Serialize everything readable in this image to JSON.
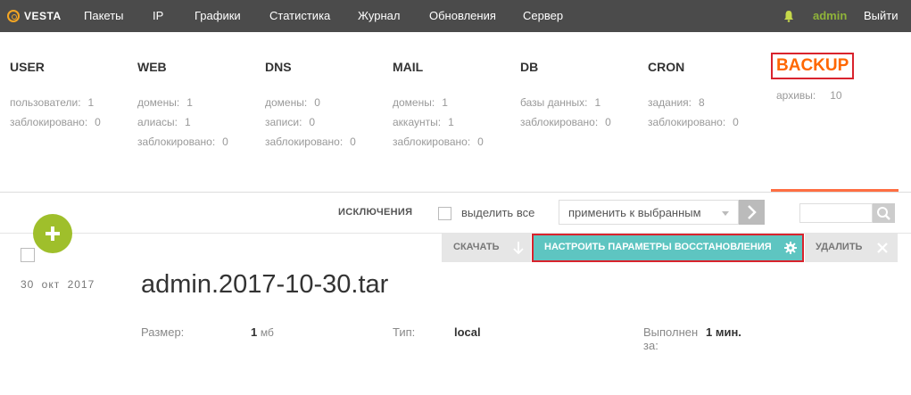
{
  "nav": {
    "logo": "VESTA",
    "items": [
      "Пакеты",
      "IP",
      "Графики",
      "Статистика",
      "Журнал",
      "Обновления",
      "Сервер"
    ],
    "user": "admin",
    "logout": "Выйти"
  },
  "stats": {
    "user": {
      "title": "USER",
      "rows": [
        [
          "пользователи:",
          "1"
        ],
        [
          "заблокировано:",
          "0"
        ]
      ]
    },
    "web": {
      "title": "WEB",
      "rows": [
        [
          "домены:",
          "1"
        ],
        [
          "алиасы:",
          "1"
        ],
        [
          "заблокировано:",
          "0"
        ]
      ]
    },
    "dns": {
      "title": "DNS",
      "rows": [
        [
          "домены:",
          "0"
        ],
        [
          "записи:",
          "0"
        ],
        [
          "заблокировано:",
          "0"
        ]
      ]
    },
    "mail": {
      "title": "MAIL",
      "rows": [
        [
          "домены:",
          "1"
        ],
        [
          "аккаунты:",
          "1"
        ],
        [
          "заблокировано:",
          "0"
        ]
      ]
    },
    "db": {
      "title": "DB",
      "rows": [
        [
          "базы данных:",
          "1"
        ],
        [
          "заблокировано:",
          "0"
        ]
      ]
    },
    "cron": {
      "title": "CRON",
      "rows": [
        [
          "задания:",
          "8"
        ],
        [
          "заблокировано:",
          "0"
        ]
      ]
    },
    "backup": {
      "title": "BACKUP",
      "rows": [
        [
          "архивы:",
          "10"
        ]
      ]
    }
  },
  "toolbar": {
    "exclusions": "ИСКЛЮЧЕНИЯ",
    "select_all": "выделить все",
    "apply_selected": "применить к выбранным"
  },
  "backup_item": {
    "date": "30 окт 2017",
    "name": "admin.2017-10-30.tar",
    "actions": {
      "download": "СКАЧАТЬ",
      "restore": "НАСТРОИТЬ ПАРАМЕТРЫ ВОССТАНОВЛЕНИЯ",
      "delete": "УДАЛИТЬ"
    },
    "size_label": "Размер:",
    "size_value": "1",
    "size_unit": "мб",
    "type_label": "Тип:",
    "type_value": "local",
    "done_label_1": "Выполнен",
    "done_label_2": "за:",
    "done_value": "1 мин."
  },
  "colors": {
    "topbar": "#4b4b4b",
    "accent_orange": "#ff6701",
    "accent_green": "#9fbf2b",
    "restore_teal": "#5ec5c1",
    "highlight_red": "#d9232d"
  }
}
